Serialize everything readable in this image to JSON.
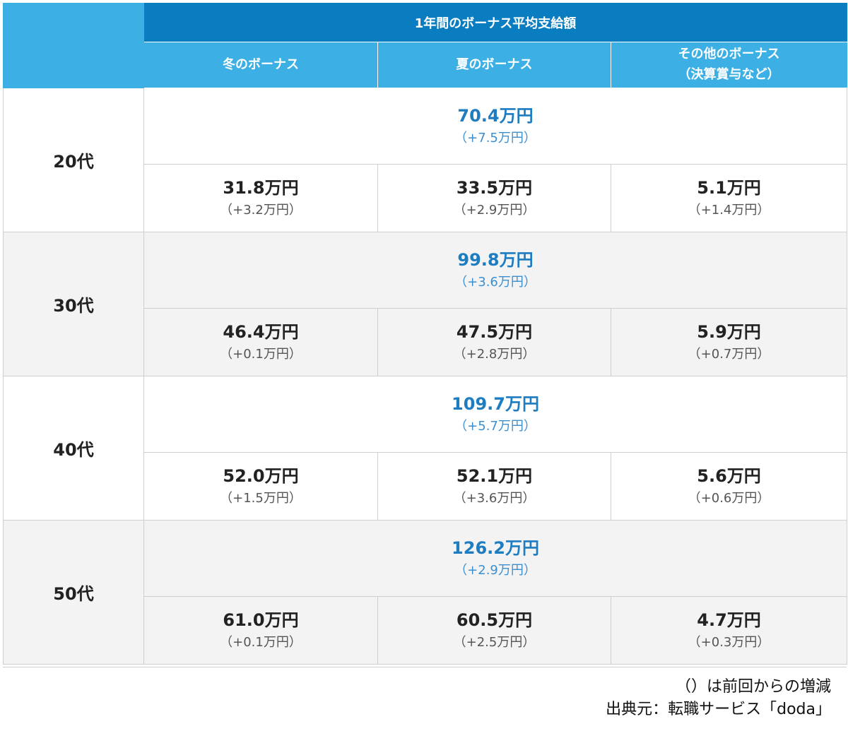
{
  "header": {
    "title": "1年間のボーナス平均支給額",
    "columns": [
      "冬のボーナス",
      "夏のボーナス",
      "その他のボーナス",
      "（決算賞与など）"
    ]
  },
  "rows": [
    {
      "age": "20代",
      "total": {
        "value": "70.4万円",
        "delta": "（+7.5万円）"
      },
      "winter": {
        "value": "31.8万円",
        "delta": "（+3.2万円）"
      },
      "summer": {
        "value": "33.5万円",
        "delta": "（+2.9万円）"
      },
      "other": {
        "value": "5.1万円",
        "delta": "（+1.4万円）"
      }
    },
    {
      "age": "30代",
      "total": {
        "value": "99.8万円",
        "delta": "（+3.6万円）"
      },
      "winter": {
        "value": "46.4万円",
        "delta": "（+0.1万円）"
      },
      "summer": {
        "value": "47.5万円",
        "delta": "（+2.8万円）"
      },
      "other": {
        "value": "5.9万円",
        "delta": "（+0.7万円）"
      }
    },
    {
      "age": "40代",
      "total": {
        "value": "109.7万円",
        "delta": "（+5.7万円）"
      },
      "winter": {
        "value": "52.0万円",
        "delta": "（+1.5万円）"
      },
      "summer": {
        "value": "52.1万円",
        "delta": "（+3.6万円）"
      },
      "other": {
        "value": "5.6万円",
        "delta": "（+0.6万円）"
      }
    },
    {
      "age": "50代",
      "total": {
        "value": "126.2万円",
        "delta": "（+2.9万円）"
      },
      "winter": {
        "value": "61.0万円",
        "delta": "（+0.1万円）"
      },
      "summer": {
        "value": "60.5万円",
        "delta": "（+2.5万円）"
      },
      "other": {
        "value": "4.7万円",
        "delta": "（+0.3万円）"
      }
    }
  ],
  "notes": {
    "line1": "（）は前回からの増減",
    "line2": "出典元：転職サービス「doda」"
  },
  "colors": {
    "header_dark": "#0a7dc0",
    "header_light": "#3cb0e5",
    "total_value": "#1e7cc1",
    "row_alt": "#f3f3f3"
  }
}
